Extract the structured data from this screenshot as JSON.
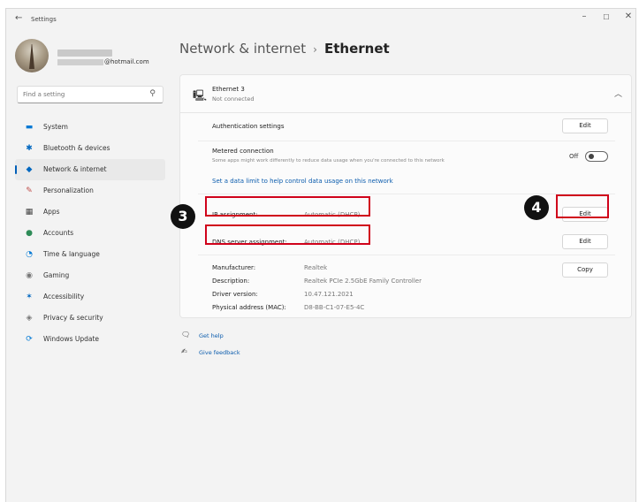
{
  "window": {
    "title": "Settings",
    "back_icon": "←",
    "minimize_icon": "–",
    "maximize_icon": "☐",
    "close_icon": "✕"
  },
  "profile": {
    "email_suffix": "@hotmail.com"
  },
  "search": {
    "placeholder": "Find a setting",
    "icon": "⚲"
  },
  "nav": {
    "items": [
      {
        "label": "System",
        "icon": "▬",
        "color": "#0078d4"
      },
      {
        "label": "Bluetooth & devices",
        "icon": "✱",
        "color": "#0067c0"
      },
      {
        "label": "Network & internet",
        "icon": "◆",
        "color": "#0067c0"
      },
      {
        "label": "Personalization",
        "icon": "✎",
        "color": "#c0504d"
      },
      {
        "label": "Apps",
        "icon": "▦",
        "color": "#444444"
      },
      {
        "label": "Accounts",
        "icon": "●",
        "color": "#2e8b57"
      },
      {
        "label": "Time & language",
        "icon": "◔",
        "color": "#0078d4"
      },
      {
        "label": "Gaming",
        "icon": "◉",
        "color": "#777777"
      },
      {
        "label": "Accessibility",
        "icon": "✶",
        "color": "#0067c0"
      },
      {
        "label": "Privacy & security",
        "icon": "◈",
        "color": "#777777"
      },
      {
        "label": "Windows Update",
        "icon": "⟳",
        "color": "#0078d4"
      }
    ],
    "active_index": 2
  },
  "breadcrumb": {
    "parent": "Network & internet",
    "separator": "›",
    "current": "Ethernet"
  },
  "ethernet": {
    "icon": "🖳",
    "name": "Ethernet 3",
    "status": "Not connected",
    "collapse_icon": "︿",
    "auth_label": "Authentication settings",
    "auth_button": "Edit",
    "metered_label": "Metered connection",
    "metered_desc": "Some apps might work differently to reduce data usage when you're connected to this network",
    "metered_state": "Off",
    "data_limit_link": "Set a data limit to help control data usage on this network",
    "ip_label": "IP assignment:",
    "ip_value": "Automatic (DHCP)",
    "ip_button": "Edit",
    "dns_label": "DNS server assignment:",
    "dns_value": "Automatic (DHCP)",
    "dns_button": "Edit",
    "copy_button": "Copy",
    "properties": [
      {
        "label": "Manufacturer:",
        "value": "Realtek"
      },
      {
        "label": "Description:",
        "value": "Realtek PCIe 2.5GbE Family Controller"
      },
      {
        "label": "Driver version:",
        "value": "10.47.121.2021"
      },
      {
        "label": "Physical address (MAC):",
        "value": "D8-BB-C1-07-E5-4C"
      }
    ]
  },
  "annotations": {
    "step3": "3",
    "step4": "4",
    "highlight_color": "#d0021b"
  },
  "help": {
    "get_help": "Get help",
    "get_help_icon": "🗨",
    "feedback": "Give feedback",
    "feedback_icon": "✍"
  }
}
